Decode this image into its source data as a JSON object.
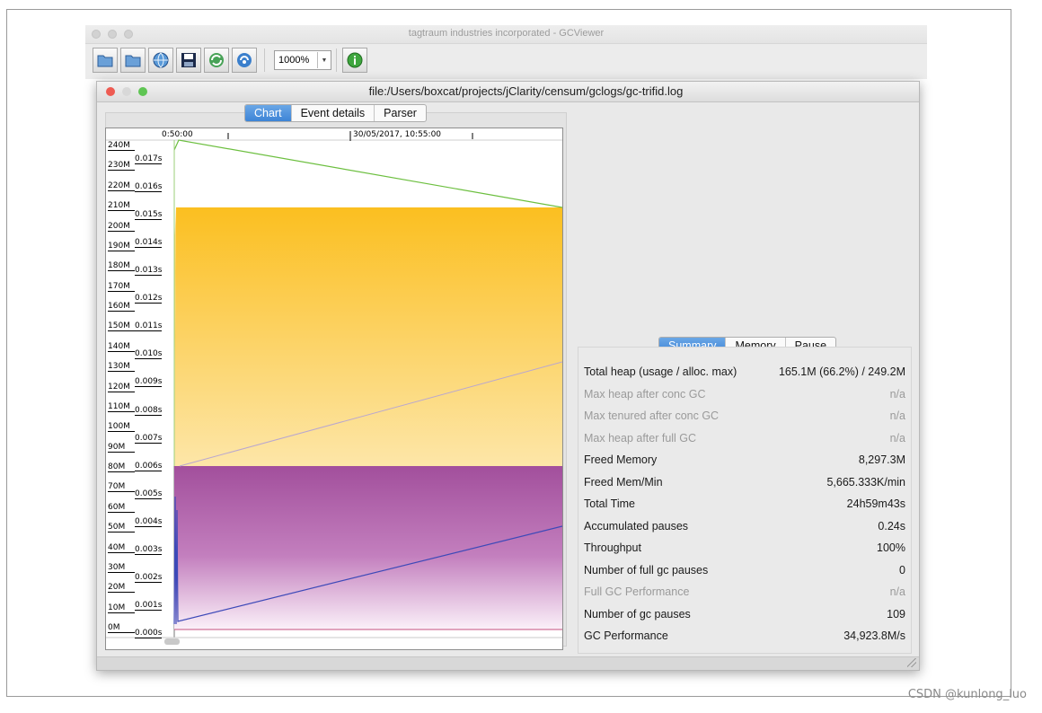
{
  "app": {
    "window_title": "tagtraum industries incorporated - GCViewer",
    "toolbar": {
      "buttons": [
        "open-file-icon",
        "open-url-icon",
        "refresh-globe-icon",
        "save-icon",
        "reload-icon",
        "watch-icon"
      ],
      "zoom_value": "1000%",
      "info_button": "info-icon"
    }
  },
  "document": {
    "title": "file:/Users/boxcat/projects/jClarity/censum/gclogs/gc-trifid.log",
    "tabs": [
      {
        "label": "Chart",
        "active": true
      },
      {
        "label": "Event details",
        "active": false
      },
      {
        "label": "Parser",
        "active": false
      }
    ]
  },
  "chart": {
    "timeline_labels": [
      "0:50:00",
      "30/05/2017, 10:55:00"
    ],
    "memory_ticks": [
      "240M",
      "230M",
      "220M",
      "210M",
      "200M",
      "190M",
      "180M",
      "170M",
      "160M",
      "150M",
      "140M",
      "130M",
      "120M",
      "110M",
      "100M",
      "90M",
      "80M",
      "70M",
      "60M",
      "50M",
      "40M",
      "30M",
      "20M",
      "10M",
      "0M"
    ],
    "pause_ticks": [
      "0.017s",
      "0.016s",
      "0.015s",
      "0.014s",
      "0.013s",
      "0.012s",
      "0.011s",
      "0.010s",
      "0.009s",
      "0.008s",
      "0.007s",
      "0.006s",
      "0.005s",
      "0.004s",
      "0.003s",
      "0.002s",
      "0.001s",
      "0.000s"
    ],
    "colors": {
      "total_heap": "#fbbf20",
      "tenured": "#a24f9c",
      "heap_line": "#6cbf3f",
      "used_line": "#3d49b8",
      "tenured_line": "#b9a7cf"
    }
  },
  "summary": {
    "tabs": [
      {
        "label": "Summary",
        "active": true
      },
      {
        "label": "Memory",
        "active": false
      },
      {
        "label": "Pause",
        "active": false
      }
    ],
    "rows": [
      {
        "label": "Total heap (usage / alloc. max)",
        "value": "165.1M (66.2%) / 249.2M",
        "dim": false
      },
      {
        "label": "Max heap after conc GC",
        "value": "n/a",
        "dim": true
      },
      {
        "label": "Max tenured after conc GC",
        "value": "n/a",
        "dim": true
      },
      {
        "label": "Max heap after full GC",
        "value": "n/a",
        "dim": true
      },
      {
        "label": "Freed Memory",
        "value": "8,297.3M",
        "dim": false
      },
      {
        "label": "Freed Mem/Min",
        "value": "5,665.333K/min",
        "dim": false
      },
      {
        "label": "Total Time",
        "value": "24h59m43s",
        "dim": false
      },
      {
        "label": "Accumulated pauses",
        "value": "0.24s",
        "dim": false
      },
      {
        "label": "Throughput",
        "value": "100%",
        "dim": false
      },
      {
        "label": "Number of full gc pauses",
        "value": "0",
        "dim": false
      },
      {
        "label": "Full GC Performance",
        "value": "n/a",
        "dim": true
      },
      {
        "label": "Number of gc pauses",
        "value": "109",
        "dim": false
      },
      {
        "label": "GC Performance",
        "value": "34,923.8M/s",
        "dim": false
      }
    ]
  },
  "watermark": "CSDN @kunlong_luo"
}
